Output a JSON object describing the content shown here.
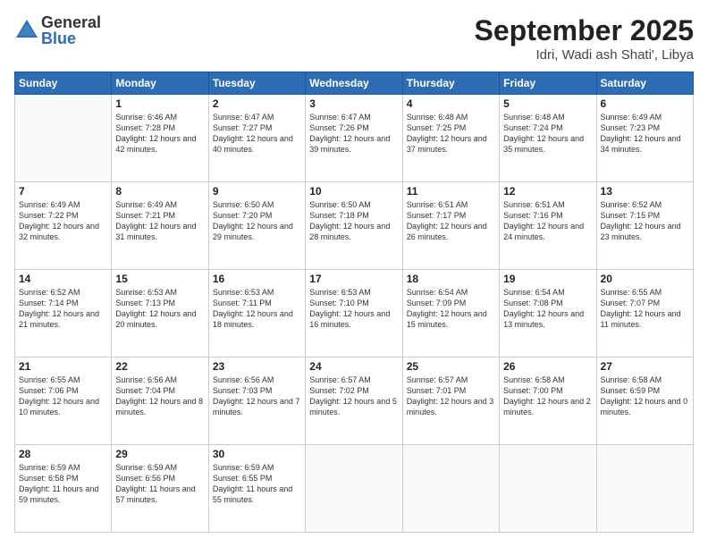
{
  "logo": {
    "general": "General",
    "blue": "Blue"
  },
  "title": "September 2025",
  "location": "Idri, Wadi ash Shati', Libya",
  "days_of_week": [
    "Sunday",
    "Monday",
    "Tuesday",
    "Wednesday",
    "Thursday",
    "Friday",
    "Saturday"
  ],
  "weeks": [
    [
      {
        "day": "",
        "sunrise": "",
        "sunset": "",
        "daylight": ""
      },
      {
        "day": "1",
        "sunrise": "Sunrise: 6:46 AM",
        "sunset": "Sunset: 7:28 PM",
        "daylight": "Daylight: 12 hours and 42 minutes."
      },
      {
        "day": "2",
        "sunrise": "Sunrise: 6:47 AM",
        "sunset": "Sunset: 7:27 PM",
        "daylight": "Daylight: 12 hours and 40 minutes."
      },
      {
        "day": "3",
        "sunrise": "Sunrise: 6:47 AM",
        "sunset": "Sunset: 7:26 PM",
        "daylight": "Daylight: 12 hours and 39 minutes."
      },
      {
        "day": "4",
        "sunrise": "Sunrise: 6:48 AM",
        "sunset": "Sunset: 7:25 PM",
        "daylight": "Daylight: 12 hours and 37 minutes."
      },
      {
        "day": "5",
        "sunrise": "Sunrise: 6:48 AM",
        "sunset": "Sunset: 7:24 PM",
        "daylight": "Daylight: 12 hours and 35 minutes."
      },
      {
        "day": "6",
        "sunrise": "Sunrise: 6:49 AM",
        "sunset": "Sunset: 7:23 PM",
        "daylight": "Daylight: 12 hours and 34 minutes."
      }
    ],
    [
      {
        "day": "7",
        "sunrise": "Sunrise: 6:49 AM",
        "sunset": "Sunset: 7:22 PM",
        "daylight": "Daylight: 12 hours and 32 minutes."
      },
      {
        "day": "8",
        "sunrise": "Sunrise: 6:49 AM",
        "sunset": "Sunset: 7:21 PM",
        "daylight": "Daylight: 12 hours and 31 minutes."
      },
      {
        "day": "9",
        "sunrise": "Sunrise: 6:50 AM",
        "sunset": "Sunset: 7:20 PM",
        "daylight": "Daylight: 12 hours and 29 minutes."
      },
      {
        "day": "10",
        "sunrise": "Sunrise: 6:50 AM",
        "sunset": "Sunset: 7:18 PM",
        "daylight": "Daylight: 12 hours and 28 minutes."
      },
      {
        "day": "11",
        "sunrise": "Sunrise: 6:51 AM",
        "sunset": "Sunset: 7:17 PM",
        "daylight": "Daylight: 12 hours and 26 minutes."
      },
      {
        "day": "12",
        "sunrise": "Sunrise: 6:51 AM",
        "sunset": "Sunset: 7:16 PM",
        "daylight": "Daylight: 12 hours and 24 minutes."
      },
      {
        "day": "13",
        "sunrise": "Sunrise: 6:52 AM",
        "sunset": "Sunset: 7:15 PM",
        "daylight": "Daylight: 12 hours and 23 minutes."
      }
    ],
    [
      {
        "day": "14",
        "sunrise": "Sunrise: 6:52 AM",
        "sunset": "Sunset: 7:14 PM",
        "daylight": "Daylight: 12 hours and 21 minutes."
      },
      {
        "day": "15",
        "sunrise": "Sunrise: 6:53 AM",
        "sunset": "Sunset: 7:13 PM",
        "daylight": "Daylight: 12 hours and 20 minutes."
      },
      {
        "day": "16",
        "sunrise": "Sunrise: 6:53 AM",
        "sunset": "Sunset: 7:11 PM",
        "daylight": "Daylight: 12 hours and 18 minutes."
      },
      {
        "day": "17",
        "sunrise": "Sunrise: 6:53 AM",
        "sunset": "Sunset: 7:10 PM",
        "daylight": "Daylight: 12 hours and 16 minutes."
      },
      {
        "day": "18",
        "sunrise": "Sunrise: 6:54 AM",
        "sunset": "Sunset: 7:09 PM",
        "daylight": "Daylight: 12 hours and 15 minutes."
      },
      {
        "day": "19",
        "sunrise": "Sunrise: 6:54 AM",
        "sunset": "Sunset: 7:08 PM",
        "daylight": "Daylight: 12 hours and 13 minutes."
      },
      {
        "day": "20",
        "sunrise": "Sunrise: 6:55 AM",
        "sunset": "Sunset: 7:07 PM",
        "daylight": "Daylight: 12 hours and 11 minutes."
      }
    ],
    [
      {
        "day": "21",
        "sunrise": "Sunrise: 6:55 AM",
        "sunset": "Sunset: 7:06 PM",
        "daylight": "Daylight: 12 hours and 10 minutes."
      },
      {
        "day": "22",
        "sunrise": "Sunrise: 6:56 AM",
        "sunset": "Sunset: 7:04 PM",
        "daylight": "Daylight: 12 hours and 8 minutes."
      },
      {
        "day": "23",
        "sunrise": "Sunrise: 6:56 AM",
        "sunset": "Sunset: 7:03 PM",
        "daylight": "Daylight: 12 hours and 7 minutes."
      },
      {
        "day": "24",
        "sunrise": "Sunrise: 6:57 AM",
        "sunset": "Sunset: 7:02 PM",
        "daylight": "Daylight: 12 hours and 5 minutes."
      },
      {
        "day": "25",
        "sunrise": "Sunrise: 6:57 AM",
        "sunset": "Sunset: 7:01 PM",
        "daylight": "Daylight: 12 hours and 3 minutes."
      },
      {
        "day": "26",
        "sunrise": "Sunrise: 6:58 AM",
        "sunset": "Sunset: 7:00 PM",
        "daylight": "Daylight: 12 hours and 2 minutes."
      },
      {
        "day": "27",
        "sunrise": "Sunrise: 6:58 AM",
        "sunset": "Sunset: 6:59 PM",
        "daylight": "Daylight: 12 hours and 0 minutes."
      }
    ],
    [
      {
        "day": "28",
        "sunrise": "Sunrise: 6:59 AM",
        "sunset": "Sunset: 6:58 PM",
        "daylight": "Daylight: 11 hours and 59 minutes."
      },
      {
        "day": "29",
        "sunrise": "Sunrise: 6:59 AM",
        "sunset": "Sunset: 6:56 PM",
        "daylight": "Daylight: 11 hours and 57 minutes."
      },
      {
        "day": "30",
        "sunrise": "Sunrise: 6:59 AM",
        "sunset": "Sunset: 6:55 PM",
        "daylight": "Daylight: 11 hours and 55 minutes."
      },
      {
        "day": "",
        "sunrise": "",
        "sunset": "",
        "daylight": ""
      },
      {
        "day": "",
        "sunrise": "",
        "sunset": "",
        "daylight": ""
      },
      {
        "day": "",
        "sunrise": "",
        "sunset": "",
        "daylight": ""
      },
      {
        "day": "",
        "sunrise": "",
        "sunset": "",
        "daylight": ""
      }
    ]
  ]
}
